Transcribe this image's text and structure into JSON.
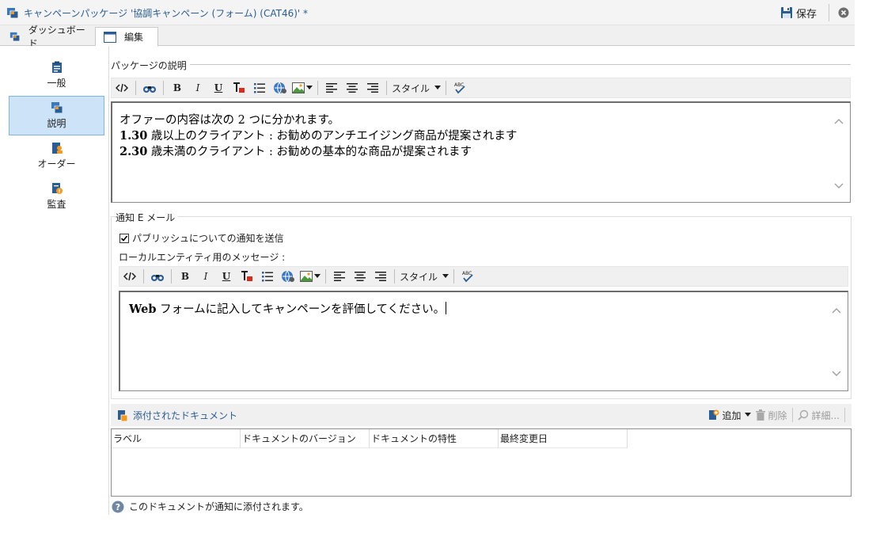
{
  "window": {
    "title": "キャンペーンパッケージ '協調キャンペーン (フォーム) (CAT46)' *",
    "save_label": "保存"
  },
  "tabs": [
    {
      "label": "ダッシュボード"
    },
    {
      "label": "編集"
    }
  ],
  "sidebar": {
    "items": [
      {
        "label": "一般",
        "icon": "clipboard-icon"
      },
      {
        "label": "説明",
        "icon": "package-icon"
      },
      {
        "label": "オーダー",
        "icon": "order-icon"
      },
      {
        "label": "監査",
        "icon": "audit-icon"
      }
    ],
    "active": "説明"
  },
  "description": {
    "section_label": "パッケージの説明",
    "style_label": "スタイル",
    "lines": [
      {
        "prefix": "",
        "text": "オファーの内容は次の 2 つに分かれます。"
      },
      {
        "prefix": "1.30",
        "text": " 歳以上のクライアント : お勧めのアンチエイジング商品が提案されます"
      },
      {
        "prefix": "2.30",
        "text": " 歳未満のクライアント : お勧めの基本的な商品が提案されます"
      }
    ]
  },
  "notification": {
    "section_label": "通知 E メール",
    "checkbox_label": "パブリッシュについての通知を送信",
    "checkbox_checked": true,
    "message_label": "ローカルエンティティ用のメッセージ :",
    "style_label": "スタイル",
    "message_prefix": "Web",
    "message_text": " フォームに記入してキャンペーンを評価してください。"
  },
  "attachments": {
    "title": "添付されたドキュメント",
    "add_label": "追加",
    "delete_label": "削除",
    "detail_label": "詳細...",
    "columns": [
      "ラベル",
      "ドキュメントのバージョン",
      "ドキュメントの特性",
      "最終変更日"
    ],
    "rows": [],
    "info_text": "このドキュメントが通知に添付されます。"
  },
  "colors": {
    "accent": "#2a5d94",
    "active_nav": "#cde3f8",
    "active_nav_border": "#7eb4ea"
  }
}
